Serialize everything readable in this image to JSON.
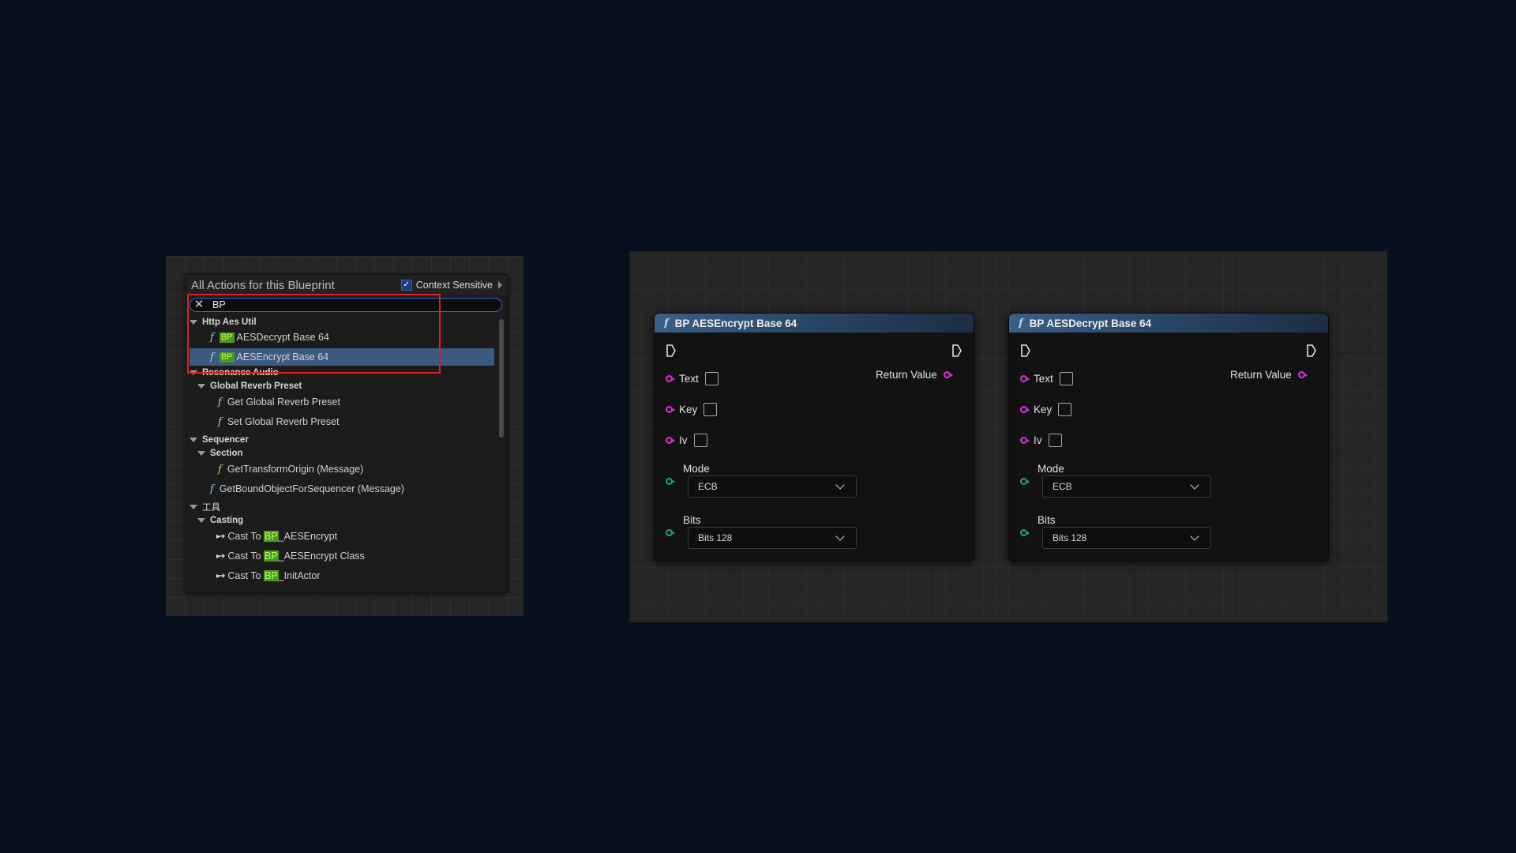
{
  "menu": {
    "title": "All Actions for this Blueprint",
    "context_sensitive_label": "Context Sensitive",
    "context_sensitive_checked": true,
    "search_value": "BP",
    "categories": {
      "http": "Http Aes Util",
      "resonance": "Resonance Audio",
      "reverb": "Global Reverb Preset",
      "sequencer": "Sequencer",
      "section": "Section",
      "tools": "工具",
      "casting": "Casting"
    },
    "items": {
      "decrypt_rest": "AESDecrypt Base 64",
      "encrypt_rest": "AESEncrypt Base 64",
      "get_reverb": "Get Global Reverb Preset",
      "set_reverb": "Set Global Reverb Preset",
      "get_transform": "GetTransformOrigin (Message)",
      "get_bound": "GetBoundObjectForSequencer (Message)",
      "cast1_pre": "Cast To ",
      "cast1_post": "_AESEncrypt",
      "cast2_pre": "Cast To ",
      "cast2_post": "_AESEncrypt Class",
      "cast3_pre": "Cast To ",
      "cast3_post": "_InitActor"
    },
    "bp_tag": "BP"
  },
  "nodes": [
    {
      "title": "BP AESEncrypt Base 64",
      "pins": {
        "text": "Text",
        "key": "Key",
        "iv": "Iv",
        "return": "Return Value"
      },
      "mode_label": "Mode",
      "mode_value": "ECB",
      "bits_label": "Bits",
      "bits_value": "Bits 128"
    },
    {
      "title": "BP AESDecrypt Base 64",
      "pins": {
        "text": "Text",
        "key": "Key",
        "iv": "Iv",
        "return": "Return Value"
      },
      "mode_label": "Mode",
      "mode_value": "ECB",
      "bits_label": "Bits",
      "bits_value": "Bits 128"
    }
  ],
  "colors": {
    "background": "#07111e",
    "pin_pink": "#e22ae2",
    "pin_teal": "#19a58c",
    "highlight": "#e02020",
    "bp_tag_bg": "#4c9a21"
  }
}
